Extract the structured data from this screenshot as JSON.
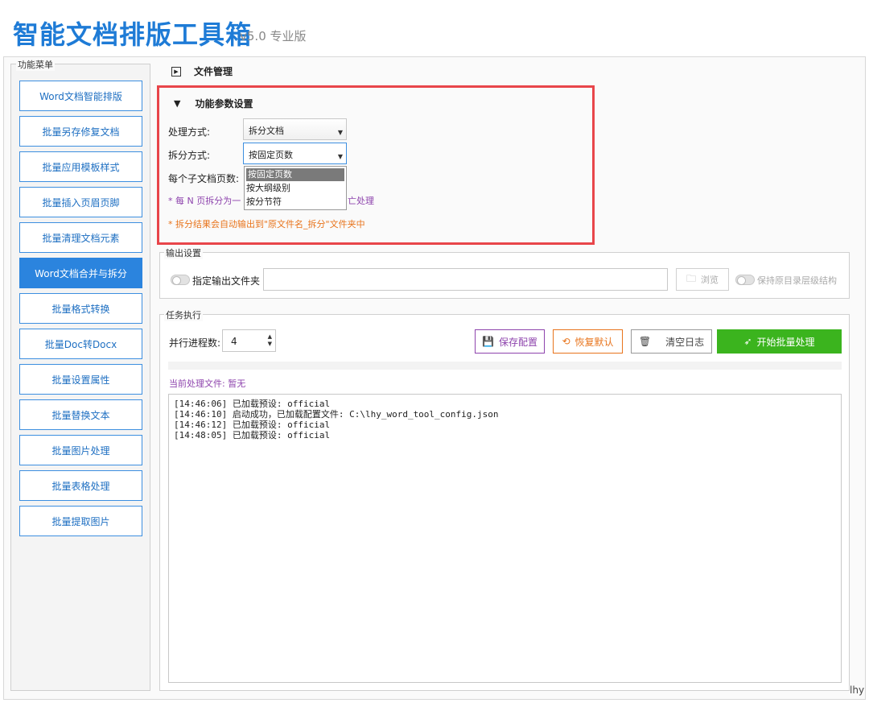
{
  "app": {
    "title": "智能文档排版工具箱",
    "version": "v5.0 专业版"
  },
  "menu": {
    "legend": "功能菜单",
    "items": [
      {
        "label": "Word文档智能排版",
        "active": false
      },
      {
        "label": "批量另存修复文档",
        "active": false
      },
      {
        "label": "批量应用模板样式",
        "active": false
      },
      {
        "label": "批量插入页眉页脚",
        "active": false
      },
      {
        "label": "批量清理文档元素",
        "active": false
      },
      {
        "label": "Word文档合并与拆分",
        "active": true
      },
      {
        "label": "批量格式转换",
        "active": false
      },
      {
        "label": "批量Doc转Docx",
        "active": false
      },
      {
        "label": "批量设置属性",
        "active": false
      },
      {
        "label": "批量替换文本",
        "active": false
      },
      {
        "label": "批量图片处理",
        "active": false
      },
      {
        "label": "批量表格处理",
        "active": false
      },
      {
        "label": "批量提取图片",
        "active": false
      }
    ]
  },
  "file_mgmt": {
    "title": "文件管理"
  },
  "params": {
    "title": "功能参数设置",
    "process_label": "处理方式:",
    "process_value": "拆分文档",
    "split_label": "拆分方式:",
    "split_value": "按固定页数",
    "pages_label": "每个子文档页数:",
    "dropdown_options": [
      "按固定页数",
      "按大纲级别",
      "按分节符"
    ],
    "note_purple_start": "* 每 N 页拆分为一",
    "note_purple_end": "亡处理",
    "note_orange": "* 拆分结果会自动输出到\"原文件名_拆分\"文件夹中"
  },
  "output": {
    "legend": "输出设置",
    "toggle_label": "指定输出文件夹",
    "browse_label": "浏览",
    "keep_structure_label": "保持原目录层级结构"
  },
  "task": {
    "legend": "任务执行",
    "threads_label": "并行进程数:",
    "threads_value": "4",
    "save_label": "保存配置",
    "restore_label": "恢复默认",
    "clear_label": "清空日志",
    "start_label": "开始批量处理",
    "current_file": "当前处理文件: 暂无",
    "log": [
      "[14:46:06] 已加载预设: official",
      "[14:46:10] 启动成功，已加载配置文件: C:\\lhy_word_tool_config.json",
      "[14:46:12] 已加载预设: official",
      "[14:48:05] 已加载预设: official"
    ]
  },
  "corner_text": "lhy",
  "colors": {
    "accent": "#2b84de",
    "start_button": "#3bb41e",
    "highlight": "#e8454a",
    "note_purple": "#8e44ad",
    "note_orange": "#e8741c"
  }
}
